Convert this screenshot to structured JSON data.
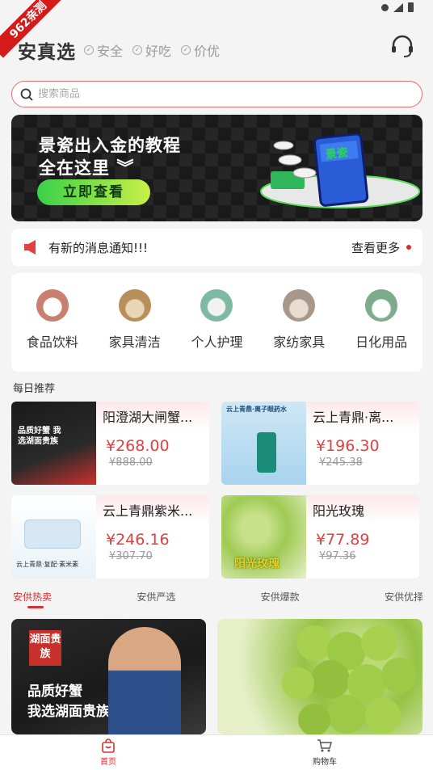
{
  "ribbon": {
    "text": "962亲测"
  },
  "header": {
    "brand": "安真选",
    "tags": [
      "安全",
      "好吃",
      "价优"
    ]
  },
  "search": {
    "placeholder": "搜索商品"
  },
  "banner": {
    "title_line1": "景瓷出入金的教程",
    "title_line2": "全在这里",
    "cta": "立即查看",
    "phone_text": "景瓷"
  },
  "notice": {
    "text": "有新的消息通知!!!",
    "more": "查看更多"
  },
  "categories": [
    {
      "label": "食品饮料",
      "color": "#c98070"
    },
    {
      "label": "家具清洁",
      "color": "#b88e5a"
    },
    {
      "label": "个人护理",
      "color": "#7fb9a4"
    },
    {
      "label": "家纺家具",
      "color": "#a8988c"
    },
    {
      "label": "日化用品",
      "color": "#7cab8e"
    }
  ],
  "daily": {
    "title": "每日推荐",
    "products": [
      {
        "name": "阳澄湖大闸蟹...",
        "price": "¥268.00",
        "old_price": "¥888.00",
        "img_text": "品质好蟹 我选湖面贵族"
      },
      {
        "name": "云上青鼎·离...",
        "price": "¥196.30",
        "old_price": "¥245.38",
        "img_text": "云上青鼎·离子眼药水"
      },
      {
        "name": "云上青鼎紫米...",
        "price": "¥246.16",
        "old_price": "¥307.70",
        "img_text": "云上青鼎·复配·素米素"
      },
      {
        "name": "阳光玫瑰",
        "price": "¥77.89",
        "old_price": "¥97.36",
        "img_text": "阳光玫瑰"
      }
    ]
  },
  "tabs": [
    "安供热卖",
    "安供严选",
    "安供爆款",
    "安供优择"
  ],
  "featured": {
    "left_logo": "湖面贵族",
    "left_text1": "品质好蟹",
    "left_text2": "我选湖面贵族"
  },
  "bottom_nav": {
    "home": "首页",
    "cart": "购物车"
  }
}
